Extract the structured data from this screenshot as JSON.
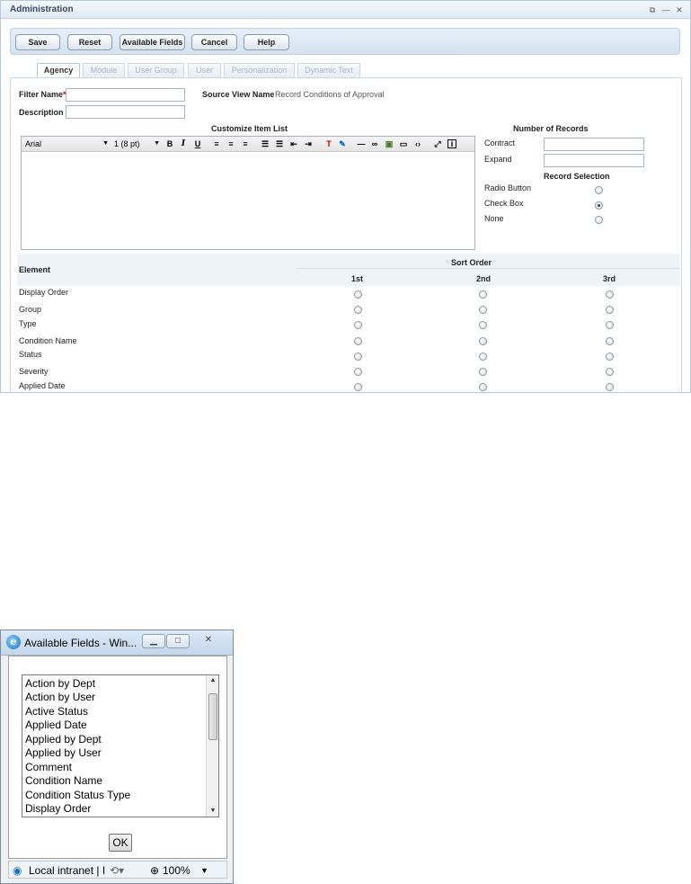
{
  "admin": {
    "title": "Administration",
    "toolbar": {
      "save": "Save",
      "reset": "Reset",
      "available_fields": "Available Fields",
      "cancel": "Cancel",
      "help": "Help"
    },
    "tabs": [
      "Agency",
      "Module",
      "User Group",
      "User",
      "Personalization",
      "Dynamic Text"
    ],
    "active_tab": "Agency",
    "form": {
      "filter_name_label": "Filter Name",
      "required_mark": "*",
      "description_label": "Description",
      "source_view_label": "Source View Name",
      "source_view_value": "Record Conditions of Approval",
      "customize_label": "Customize Item List",
      "editor": {
        "font": "Arial",
        "size": "1 (8 pt)",
        "bold": "B",
        "italic": "I",
        "underline": "U"
      },
      "number_of_records_label": "Number of Records",
      "contract_label": "Contract",
      "expand_label": "Expand",
      "record_selection_label": "Record Selection",
      "selection_options": [
        {
          "label": "Radio Button",
          "checked": false
        },
        {
          "label": "Check Box",
          "checked": true
        },
        {
          "label": "None",
          "checked": false
        }
      ]
    },
    "sort_table": {
      "element_header": "Element",
      "sort_order_header": "Sort Order",
      "columns": [
        "1st",
        "2nd",
        "3rd"
      ],
      "rows": [
        "Display Order",
        "Group",
        "Type",
        "Condition Name",
        "Status",
        "Severity",
        "Applied Date"
      ]
    }
  },
  "popup": {
    "title": "Available Fields - Win...",
    "items": [
      "Action by Dept",
      "Action by User",
      "Active Status",
      "Applied Date",
      "Applied by Dept",
      "Applied by User",
      "Comment",
      "Condition Name",
      "Condition Status Type",
      "Display Order"
    ],
    "ok_label": "OK",
    "status": {
      "zone": "Local intranet | I",
      "zoom": "100%"
    }
  }
}
